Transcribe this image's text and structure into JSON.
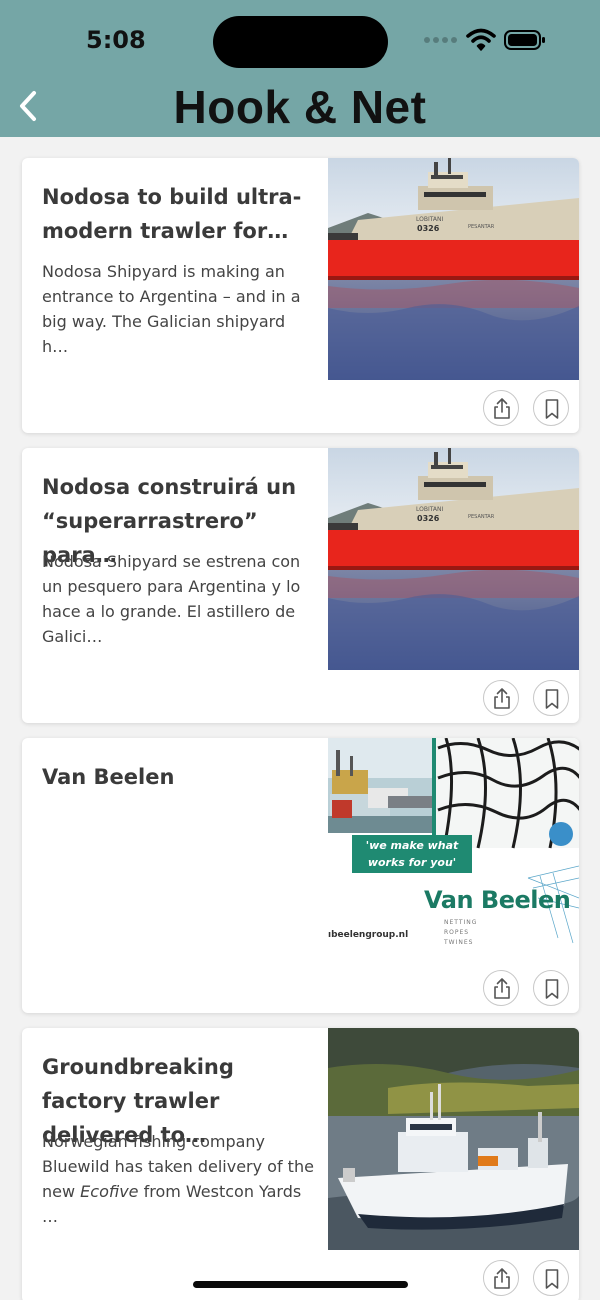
{
  "status_bar": {
    "time": "5:08"
  },
  "header": {
    "title": "Hook & Net",
    "back_icon": "chevron-left-icon",
    "background": "#75a6a6"
  },
  "articles": [
    {
      "title": "Nodosa to build ultra-modern trawler for…",
      "summary": "Nodosa Shipyard is making an entrance to Argentina – and in a big way. The Galician shipyard h…",
      "image": "red-trawler-in-harbor",
      "hull_number": "0326",
      "ship_name": "PESANTAR"
    },
    {
      "title": "Nodosa construirá un “superarrastrero” para…",
      "summary": "Nodosa Shipyard se estrena con un pesquero para Argentina y lo hace a lo grande. El astillero de Galici…",
      "image": "red-trawler-in-harbor",
      "hull_number": "0326",
      "ship_name": "PESANTAR"
    },
    {
      "title": "Van Beelen",
      "summary": "",
      "image": "van-beelen-advert",
      "ad_tagline_1": "'we make what",
      "ad_tagline_2": "works for you'",
      "ad_brand": "Van Beelen",
      "ad_sub_1": "NETTING",
      "ad_sub_2": "ROPES",
      "ad_sub_3": "TWINES",
      "ad_url": "ıbeelengroup.nl"
    },
    {
      "title": "Groundbreaking factory trawler delivered to…",
      "summary_pre": "Norwegian fishing company Bluewild has taken delivery of the new ",
      "summary_em": "Ecofive",
      "summary_post": " from Westcon Yards …",
      "image": "white-factory-trawler-in-fjord"
    }
  ],
  "actions": {
    "share_icon": "share-icon",
    "bookmark_icon": "bookmark-icon"
  },
  "colors": {
    "accent": "#75a6a6",
    "hull_red": "#e8251c",
    "brand_green": "#1b7a64"
  }
}
